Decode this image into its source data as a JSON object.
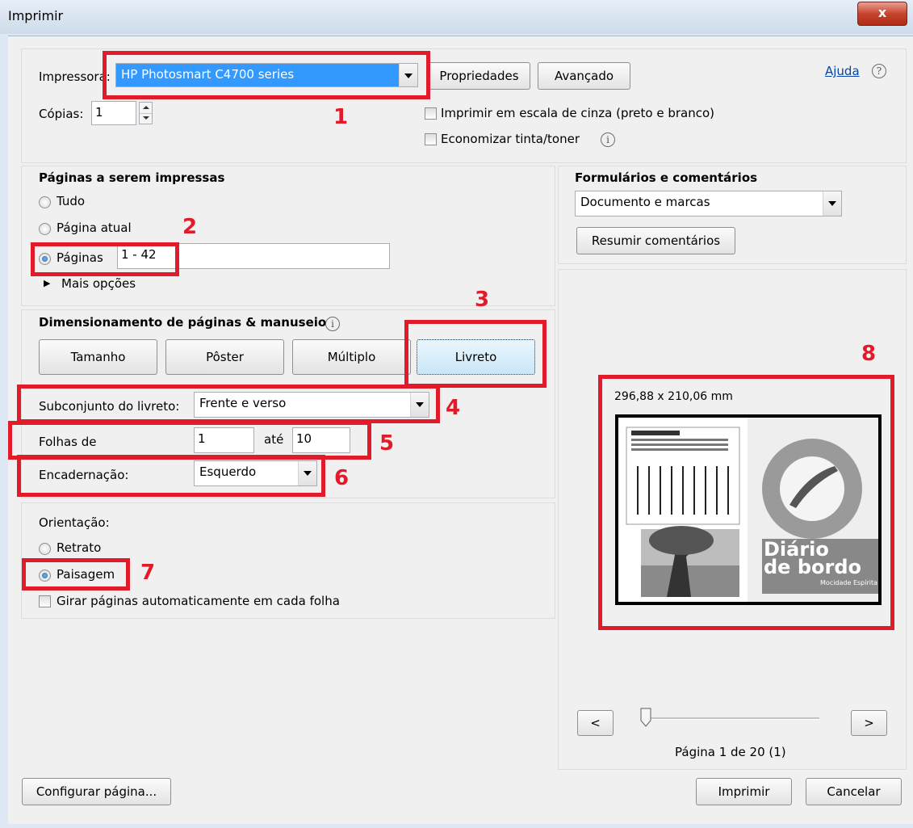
{
  "window": {
    "title": "Imprimir",
    "close": "x"
  },
  "printer": {
    "label": "Impressora:",
    "selected": "HP Photosmart C4700 series",
    "properties_button": "Propriedades",
    "advanced_button": "Avançado",
    "help_link": "Ajuda",
    "copies_label": "Cópias:",
    "copies_value": "1",
    "grayscale_label": "Imprimir em escala de cinza (preto e branco)",
    "save_ink_label": "Economizar tinta/toner"
  },
  "pages": {
    "heading": "Páginas a serem impressas",
    "all": "Tudo",
    "current": "Página atual",
    "pages": "Páginas",
    "range": "1 - 42",
    "more": "Mais opções"
  },
  "forms": {
    "heading": "Formulários e comentários",
    "selected": "Documento e marcas",
    "summarize_button": "Resumir comentários"
  },
  "sizing": {
    "heading": "Dimensionamento de páginas & manuseio",
    "size": "Tamanho",
    "poster": "Pôster",
    "multiple": "Múltiplo",
    "booklet": "Livreto",
    "subset_label": "Subconjunto do livreto:",
    "subset_value": "Frente e verso",
    "sheets_label": "Folhas de",
    "sheets_from": "1",
    "sheets_to_label": "até",
    "sheets_to": "10",
    "binding_label": "Encadernação:",
    "binding_value": "Esquerdo"
  },
  "orientation": {
    "heading": "Orientação:",
    "portrait": "Retrato",
    "landscape": "Paisagem",
    "auto_rotate": "Girar páginas automaticamente em cada folha"
  },
  "preview": {
    "dimensions": "296,88 x 210,06 mm",
    "prev": "<",
    "next": ">",
    "page_info": "Página 1 de 20 (1)",
    "cover_title_1": "Diário",
    "cover_title_2": "de bordo",
    "cover_subtitle": "Mocidade Espírita"
  },
  "footer": {
    "page_setup": "Configurar página...",
    "print": "Imprimir",
    "cancel": "Cancelar"
  },
  "annotations": [
    "1",
    "2",
    "3",
    "4",
    "5",
    "6",
    "7",
    "8"
  ],
  "colors": {
    "annotation": "#e21b2a",
    "selection": "#3399ff"
  }
}
